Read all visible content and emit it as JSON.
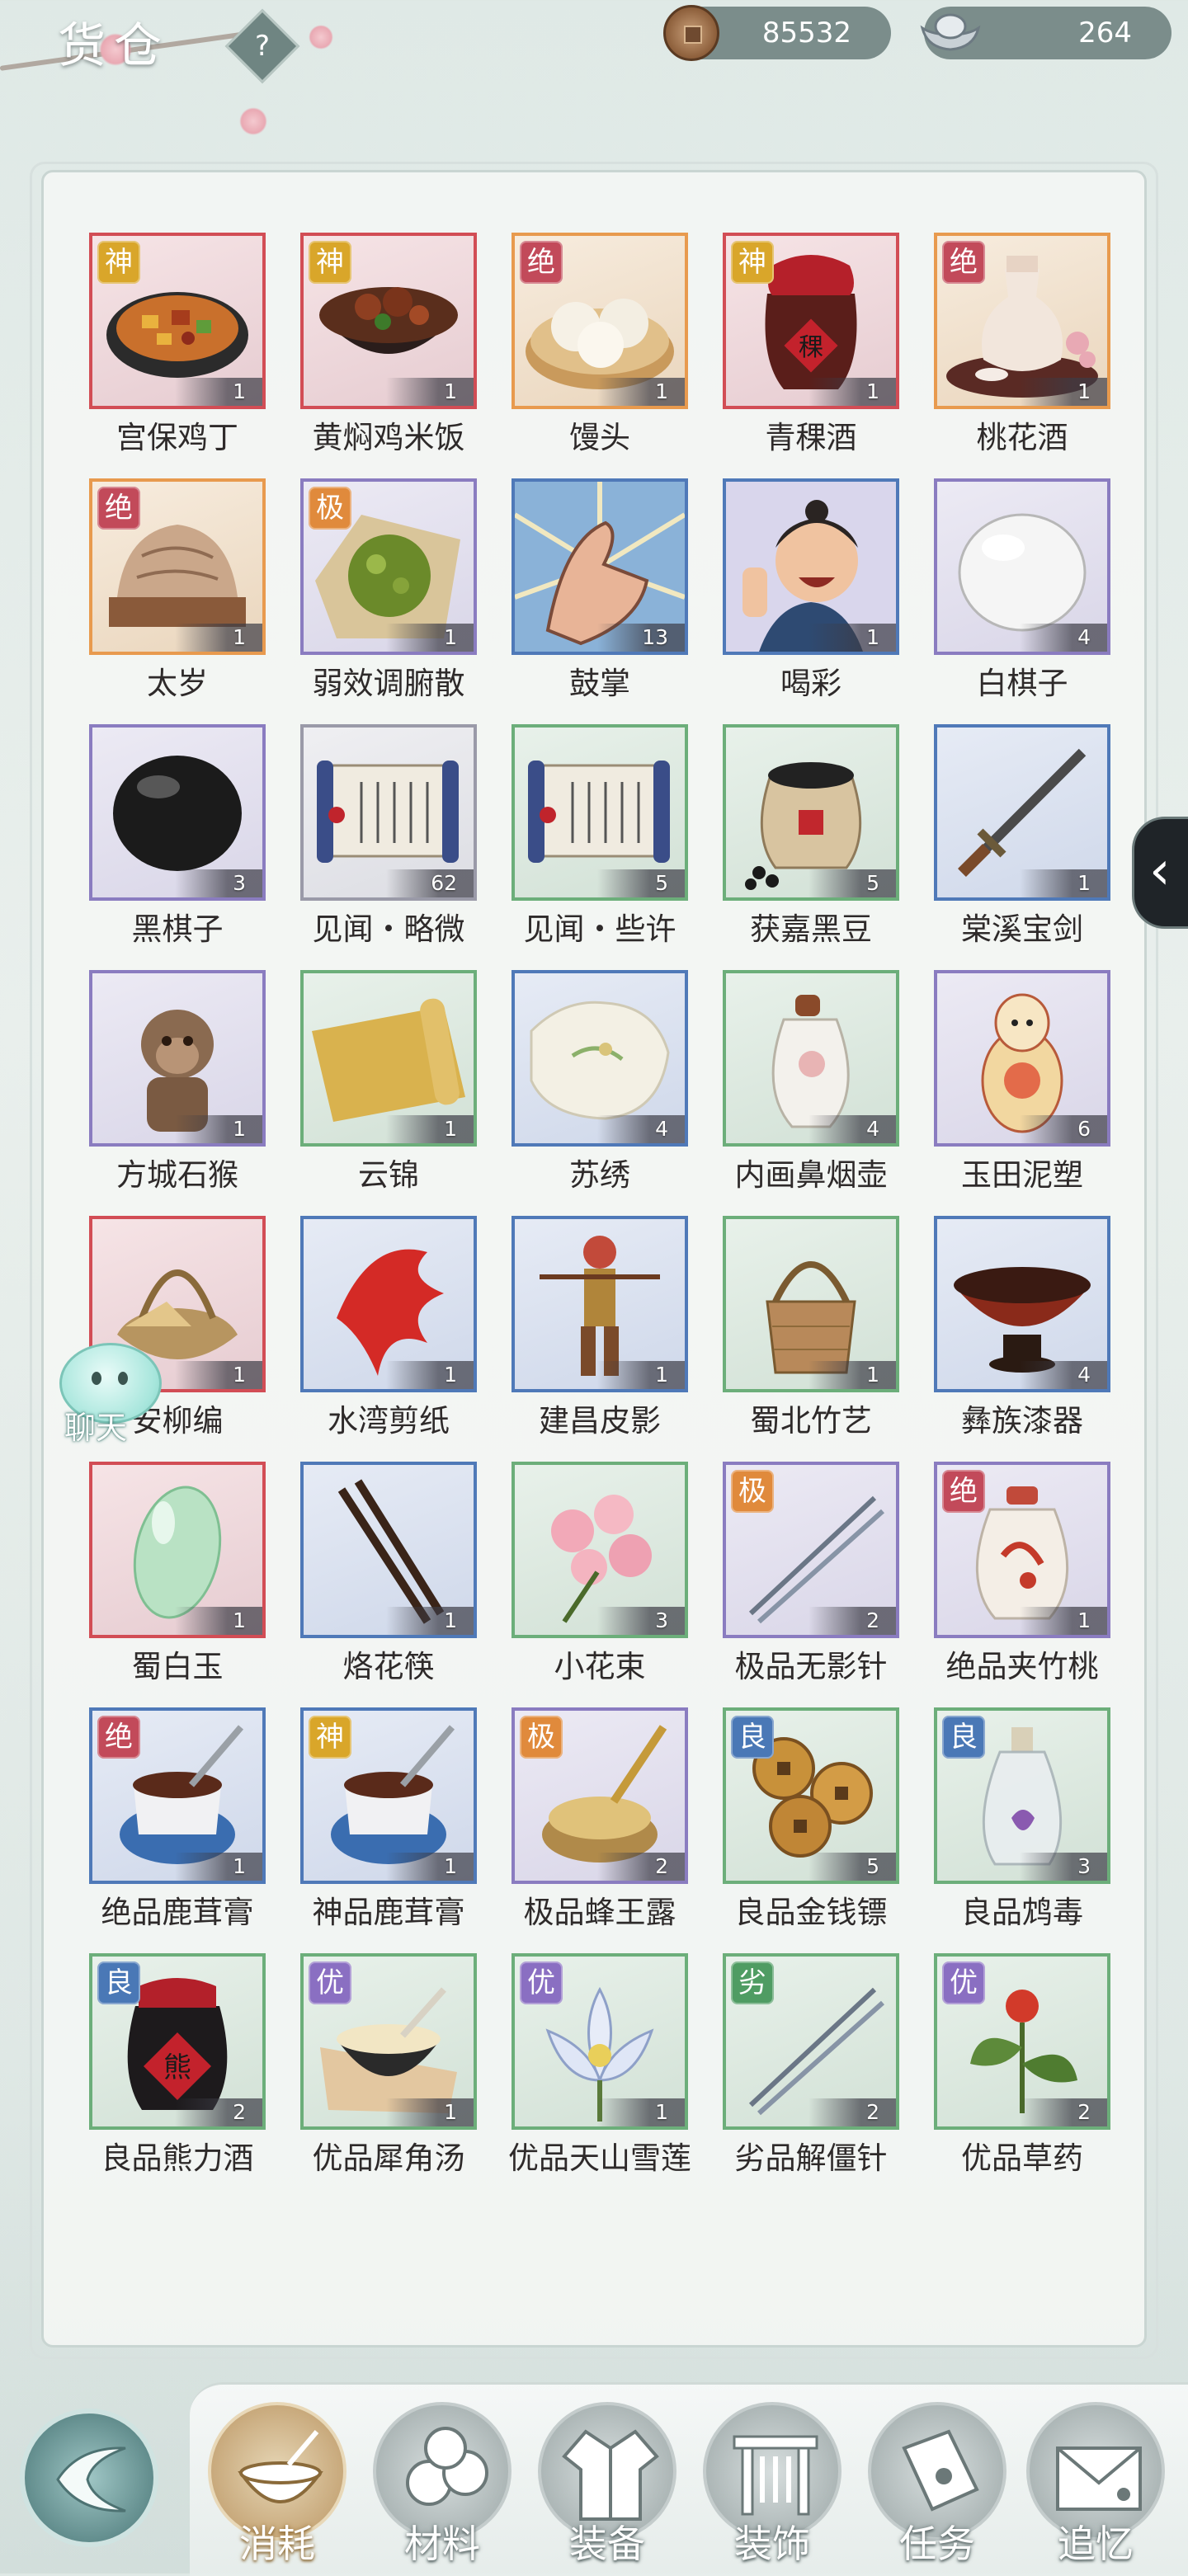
{
  "header": {
    "title": "货仓",
    "help_label": "?",
    "currencies": [
      {
        "icon": "copper-coin-icon",
        "value": "85532"
      },
      {
        "icon": "silver-ingot-icon",
        "value": "264"
      }
    ]
  },
  "inventory": {
    "items": [
      {
        "name": "宫保鸡丁",
        "count": "1",
        "badge": "神",
        "rarity": "red",
        "icon": "kung-pao-chicken-icon"
      },
      {
        "name": "黄焖鸡米饭",
        "count": "1",
        "badge": "神",
        "rarity": "red",
        "icon": "braised-chicken-rice-icon"
      },
      {
        "name": "馒头",
        "count": "1",
        "badge": "绝",
        "rarity": "orange",
        "icon": "steamed-bun-icon"
      },
      {
        "name": "青稞酒",
        "count": "1",
        "badge": "神",
        "rarity": "red",
        "icon": "barley-wine-jar-icon"
      },
      {
        "name": "桃花酒",
        "count": "1",
        "badge": "绝",
        "rarity": "orange",
        "icon": "peach-blossom-wine-icon"
      },
      {
        "name": "太岁",
        "count": "1",
        "badge": "绝",
        "rarity": "orange",
        "icon": "taisui-fungus-icon"
      },
      {
        "name": "弱效调腑散",
        "count": "1",
        "badge": "极",
        "rarity": "purple",
        "icon": "herbal-powder-icon"
      },
      {
        "name": "鼓掌",
        "count": "13",
        "badge": "",
        "rarity": "blue",
        "icon": "clapping-hands-icon"
      },
      {
        "name": "喝彩",
        "count": "1",
        "badge": "",
        "rarity": "blue",
        "icon": "cheering-person-icon"
      },
      {
        "name": "白棋子",
        "count": "4",
        "badge": "",
        "rarity": "purple",
        "icon": "white-go-stone-icon"
      },
      {
        "name": "黑棋子",
        "count": "3",
        "badge": "",
        "rarity": "purple",
        "icon": "black-go-stone-icon"
      },
      {
        "name": "见闻・略微",
        "count": "62",
        "badge": "",
        "rarity": "gray",
        "icon": "scroll-icon"
      },
      {
        "name": "见闻・些许",
        "count": "5",
        "badge": "",
        "rarity": "green",
        "icon": "scroll-icon"
      },
      {
        "name": "获嘉黑豆",
        "count": "5",
        "badge": "",
        "rarity": "green",
        "icon": "black-beans-jar-icon"
      },
      {
        "name": "棠溪宝剑",
        "count": "1",
        "badge": "",
        "rarity": "blue",
        "icon": "sword-icon"
      },
      {
        "name": "方城石猴",
        "count": "1",
        "badge": "",
        "rarity": "purple",
        "icon": "stone-monkey-icon"
      },
      {
        "name": "云锦",
        "count": "1",
        "badge": "",
        "rarity": "green",
        "icon": "brocade-cloth-icon"
      },
      {
        "name": "苏绣",
        "count": "4",
        "badge": "",
        "rarity": "blue",
        "icon": "embroidery-icon"
      },
      {
        "name": "内画鼻烟壶",
        "count": "4",
        "badge": "",
        "rarity": "green",
        "icon": "snuff-bottle-icon"
      },
      {
        "name": "玉田泥塑",
        "count": "6",
        "badge": "",
        "rarity": "purple",
        "icon": "clay-figure-icon"
      },
      {
        "name": "安柳编",
        "count": "1",
        "badge": "",
        "rarity": "red",
        "icon": "willow-basket-icon"
      },
      {
        "name": "水湾剪纸",
        "count": "1",
        "badge": "",
        "rarity": "blue",
        "icon": "paper-cut-icon"
      },
      {
        "name": "建昌皮影",
        "count": "1",
        "badge": "",
        "rarity": "blue",
        "icon": "shadow-puppet-icon"
      },
      {
        "name": "蜀北竹艺",
        "count": "1",
        "badge": "",
        "rarity": "green",
        "icon": "bamboo-basket-icon"
      },
      {
        "name": "彝族漆器",
        "count": "4",
        "badge": "",
        "rarity": "blue",
        "icon": "lacquer-bowl-icon"
      },
      {
        "name": "蜀白玉",
        "count": "1",
        "badge": "",
        "rarity": "red",
        "icon": "white-jade-icon"
      },
      {
        "name": "烙花筷",
        "count": "1",
        "badge": "",
        "rarity": "blue",
        "icon": "chopsticks-icon"
      },
      {
        "name": "小花束",
        "count": "3",
        "badge": "",
        "rarity": "green",
        "icon": "flower-bouquet-icon"
      },
      {
        "name": "极品无影针",
        "count": "2",
        "badge": "极",
        "rarity": "purple",
        "icon": "needles-icon"
      },
      {
        "name": "绝品夹竹桃",
        "count": "1",
        "badge": "绝",
        "rarity": "purple",
        "icon": "oleander-vase-icon"
      },
      {
        "name": "绝品鹿茸膏",
        "count": "1",
        "badge": "绝",
        "rarity": "blue",
        "icon": "antler-paste-icon"
      },
      {
        "name": "神品鹿茸膏",
        "count": "1",
        "badge": "神",
        "rarity": "blue",
        "icon": "antler-paste-icon"
      },
      {
        "name": "极品蜂王露",
        "count": "2",
        "badge": "极",
        "rarity": "purple",
        "icon": "royal-jelly-icon"
      },
      {
        "name": "良品金钱镖",
        "count": "5",
        "badge": "良",
        "rarity": "green",
        "icon": "coin-darts-icon"
      },
      {
        "name": "良品鸩毒",
        "count": "3",
        "badge": "良",
        "rarity": "green",
        "icon": "poison-bottle-icon"
      },
      {
        "name": "良品熊力酒",
        "count": "2",
        "badge": "良",
        "rarity": "green",
        "icon": "bear-wine-jar-icon"
      },
      {
        "name": "优品犀角汤",
        "count": "1",
        "badge": "优",
        "rarity": "green",
        "icon": "soup-bowl-icon"
      },
      {
        "name": "优品天山雪莲",
        "count": "1",
        "badge": "优",
        "rarity": "green",
        "icon": "snow-lotus-icon"
      },
      {
        "name": "劣品解僵针",
        "count": "2",
        "badge": "劣",
        "rarity": "green",
        "icon": "needles-icon"
      },
      {
        "name": "优品草药",
        "count": "2",
        "badge": "优",
        "rarity": "green",
        "icon": "herb-icon"
      }
    ]
  },
  "side_tab": {
    "label": "‹"
  },
  "chat": {
    "label": "聊天"
  },
  "bottom_nav": {
    "tabs": [
      {
        "label": "消耗",
        "icon": "bowl-icon",
        "active": true
      },
      {
        "label": "材料",
        "icon": "materials-icon",
        "active": false
      },
      {
        "label": "装备",
        "icon": "robe-icon",
        "active": false
      },
      {
        "label": "装饰",
        "icon": "gate-icon",
        "active": false
      },
      {
        "label": "任务",
        "icon": "task-book-icon",
        "active": false
      },
      {
        "label": "追忆",
        "icon": "letter-icon",
        "active": false
      }
    ]
  },
  "colors": {
    "rarity_red": "#d24d55",
    "rarity_orange": "#e89a4e",
    "rarity_blue": "#4f79b8",
    "rarity_green": "#6cae7a",
    "rarity_purple": "#8a7cc0",
    "active_tab": "#c4a374"
  }
}
